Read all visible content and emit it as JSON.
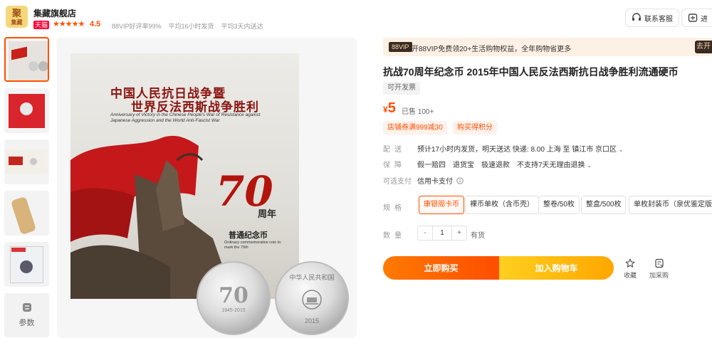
{
  "store": {
    "logo_text_big": "聚",
    "logo_text_small": "集藏",
    "name": "集藏旗舰店",
    "badge": "天猫",
    "stars": "★★★★★",
    "rating": "4.5",
    "metrics": [
      "88VIP好评率99%",
      "平均16小时发货",
      "平均3天内送达"
    ],
    "service_button": "联系客服",
    "enter_button": "进"
  },
  "gallery": {
    "param_label": "参数",
    "image_text": {
      "cn_line1": "中国人民抗日战争暨",
      "cn_line2": "世界反法西斯战争胜利",
      "en_caption": "Anniversary of Victory in the Chinese People's War of Resistance against Japanese Aggression and the World Anti-Fascist War",
      "seventy": "70",
      "zhou_nian": "周年",
      "coin_name": "普通纪念币",
      "coin_en": "Ordinary commemorative coin to mark the 70th",
      "coin_left_years": "1945-2015",
      "coin_right_year": "2015",
      "coin_right_text": "中华人民共和国"
    }
  },
  "vip_banner": {
    "badge": "88VIP",
    "text": "开88VIP免费领20+生活购物权益，全年购物省更多",
    "button": "去开"
  },
  "product": {
    "title": "抗战70周年纪念币 2015年中国人民反法西斯抗日战争胜利流通硬币",
    "invoice": "可开发票",
    "currency": "¥",
    "price": "5",
    "sold": "已售 100+",
    "coupons": [
      "店铺券满999减30",
      "购买得积分"
    ]
  },
  "delivery": {
    "label": "配送",
    "text": "预计17小时内发货，明天送达  快递: 8.00  上海  至  镇江市 京口区"
  },
  "guarantee": {
    "label": "保障",
    "items": [
      "假一赔四",
      "退货宝",
      "极速退款",
      "不支持7天无理由退换"
    ]
  },
  "payment": {
    "label": "可选支付",
    "text": "信用卡支付"
  },
  "specs": {
    "label": "规格",
    "options": [
      "康银阁卡币",
      "裸币单枚（含币壳）",
      "整卷/50枚",
      "整盒/500枚",
      "单枚封装币（泉优鉴定版）"
    ],
    "selected": 0
  },
  "quantity": {
    "label": "数量",
    "minus": "-",
    "value": "1",
    "plus": "+",
    "stock": "有货"
  },
  "actions": {
    "buy_now": "立即购买",
    "add_to_cart": "加入购物车",
    "favorite": "收藏",
    "add_to_list": "加采购"
  }
}
